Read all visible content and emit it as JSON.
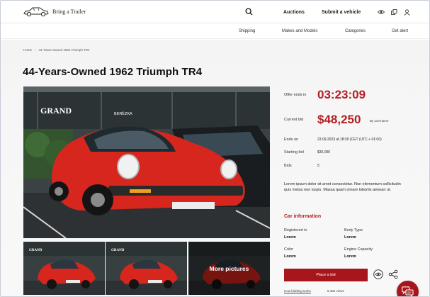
{
  "header": {
    "logo_text": "Bring a Trailer",
    "nav": {
      "auctions": "Auctions",
      "submit": "Submit a vehicle"
    },
    "icons": [
      "search-icon",
      "eye-icon",
      "copy-icon",
      "user-icon"
    ]
  },
  "subnav": {
    "items": [
      "Shipping",
      "Makes and Models",
      "Categories",
      "Get alert"
    ]
  },
  "breadcrumb": {
    "home": "Home",
    "current": "44-Years-Owned 1962 Triumph TR4"
  },
  "listing": {
    "title": "44-Years-Owned 1962 Triumph TR4",
    "sign_text": "GRAND",
    "sign_text2": "BERĚZKA"
  },
  "photos": {
    "more_label": "More pictures"
  },
  "auction": {
    "offer_ends_label": "Offer ends in",
    "timer": "03:23:09",
    "current_bid_label": "Current bid",
    "current_bid": "$48,250",
    "by_user": "By username",
    "ends_on_label": "Ends on",
    "ends_on_value": "23.09.2023 at 18:30 (CET (UTC + 01:00)",
    "starting_bid_label": "Starting bid",
    "starting_bid_value": "$30,000",
    "bids_label": "Bids",
    "bids_value": "5"
  },
  "description": "Lorem ipsum dolor sit amet consectetur. Non elementum sollicitudin quis metus non turpis. Massa quam ornare lobortis aenean ut.",
  "car_info": {
    "heading": "Car information",
    "fields": [
      {
        "label": "Registered in",
        "value": "Lorem"
      },
      {
        "label": "Body Type",
        "value": "Lorem"
      },
      {
        "label": "Color",
        "value": "Lorem"
      },
      {
        "label": "Engine Capacity",
        "value": "Lorem"
      }
    ]
  },
  "actions": {
    "place_bid": "Place a bid",
    "how_works": "How bidding works",
    "views": "8,455 views"
  },
  "colors": {
    "accent": "#a6161b",
    "timer": "#b32024"
  }
}
